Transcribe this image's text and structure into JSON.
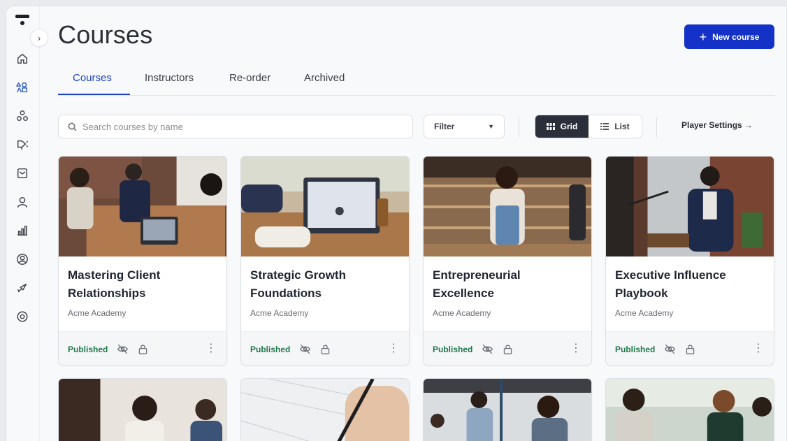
{
  "page": {
    "title": "Courses"
  },
  "header": {
    "new_course_label": "New course"
  },
  "tabs": [
    {
      "label": "Courses",
      "active": true
    },
    {
      "label": "Instructors",
      "active": false
    },
    {
      "label": "Re-order",
      "active": false
    },
    {
      "label": "Archived",
      "active": false
    }
  ],
  "toolbar": {
    "search_placeholder": "Search courses by name",
    "filter_label": "Filter",
    "grid_label": "Grid",
    "list_label": "List",
    "player_settings_label": "Player Settings →",
    "active_view": "grid"
  },
  "sidebar": {
    "icons": [
      "home-icon",
      "courses-icon",
      "groups-icon",
      "marketing-icon",
      "inbox-icon",
      "user-icon",
      "analytics-icon",
      "profile-icon",
      "launch-icon",
      "settings-icon"
    ],
    "active": "courses-icon"
  },
  "courses": [
    {
      "title": "Mastering Client Relationships",
      "provider": "Acme Academy",
      "status": "Published"
    },
    {
      "title": "Strategic Growth Foundations",
      "provider": "Acme Academy",
      "status": "Published"
    },
    {
      "title": "Entrepreneurial Excellence",
      "provider": "Acme Academy",
      "status": "Published"
    },
    {
      "title": "Executive Influence Playbook",
      "provider": "Acme Academy",
      "status": "Published"
    }
  ],
  "colors": {
    "primary": "#1432c8",
    "tab_active": "#1f43c9",
    "published": "#1f7a4a",
    "grid_active_bg": "#2a2f3a"
  }
}
